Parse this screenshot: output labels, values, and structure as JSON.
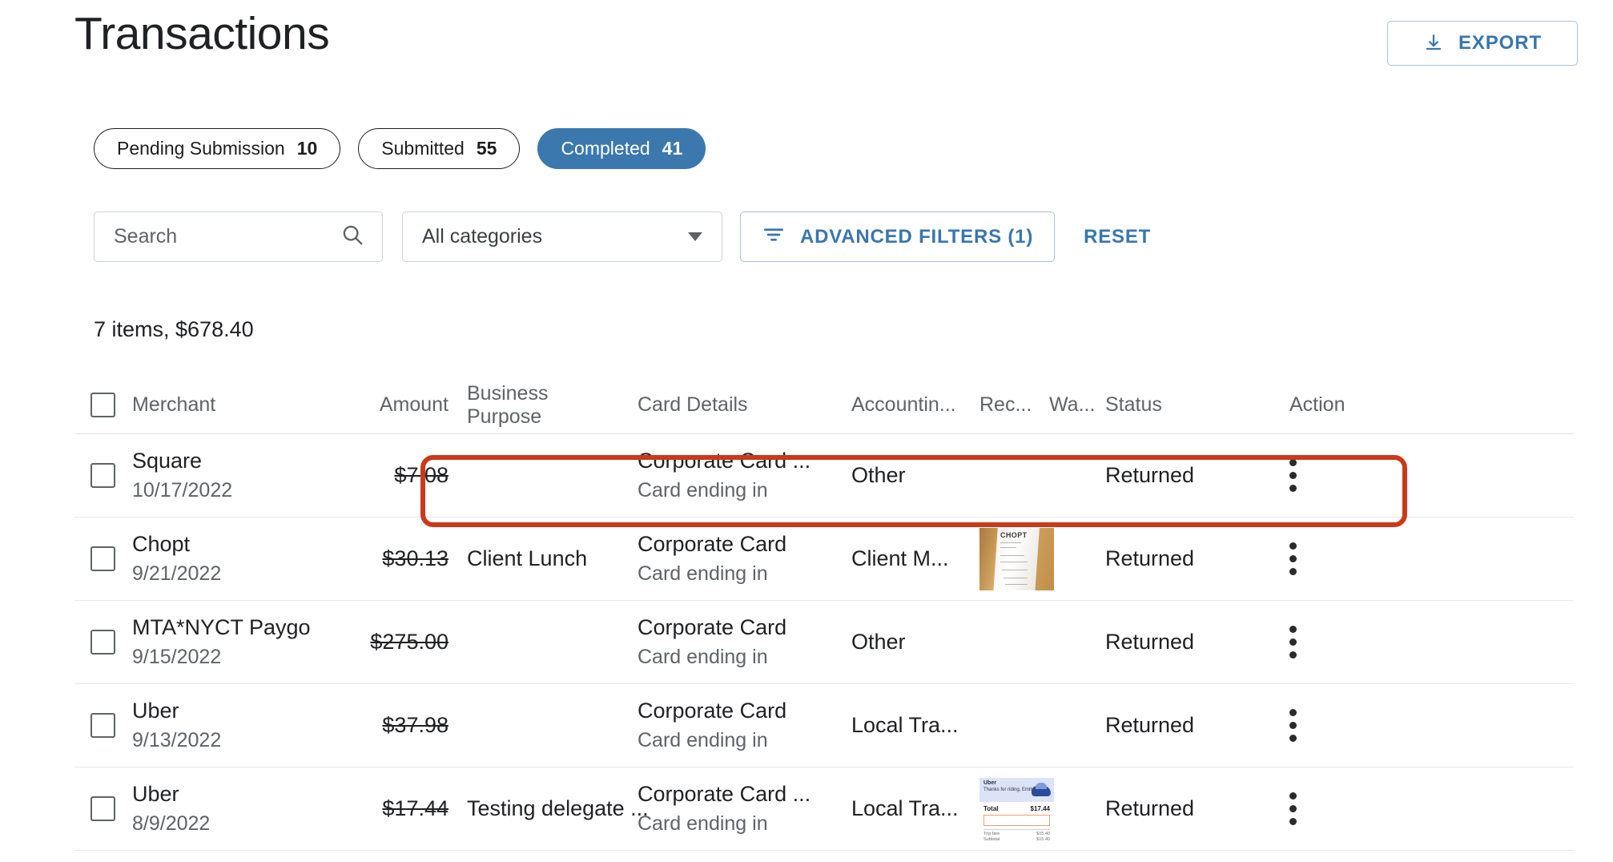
{
  "header": {
    "title": "Transactions",
    "export_label": "EXPORT",
    "export_icon": "download-icon"
  },
  "tabs": [
    {
      "label": "Pending Submission",
      "count": "10",
      "active": false
    },
    {
      "label": "Submitted",
      "count": "55",
      "active": false
    },
    {
      "label": "Completed",
      "count": "41",
      "active": true
    }
  ],
  "filters": {
    "search_placeholder": "Search",
    "search_value": "",
    "search_icon": "search-icon",
    "category_selected": "All categories",
    "category_icon": "chevron-down-icon",
    "advanced_filters_label": "ADVANCED FILTERS  (1)",
    "advanced_filters_icon": "filter-icon",
    "reset_label": "RESET"
  },
  "summary": "7 items, $678.40",
  "table": {
    "columns": [
      "Merchant",
      "Amount",
      "Business Purpose",
      "Card Details",
      "Accountin...",
      "Rec...",
      "Wa...",
      "Status",
      "Action"
    ],
    "rows": [
      {
        "merchant": "Square",
        "date": "10/17/2022",
        "amount": "$7.08",
        "purpose": "",
        "card": "Corporate Card ...",
        "card_sub": "Card ending in",
        "accounting": "Other",
        "receipt": "",
        "wallet": "",
        "status": "Returned",
        "action_icon": "more-vertical-icon"
      },
      {
        "merchant": "Chopt",
        "date": "9/21/2022",
        "amount": "$30.13",
        "purpose": "Client Lunch",
        "card": "Corporate Card",
        "card_sub": "Card ending in",
        "accounting": "Client M...",
        "receipt": "chopt-receipt-thumbnail",
        "wallet": "",
        "status": "Returned",
        "action_icon": "more-vertical-icon"
      },
      {
        "merchant": "MTA*NYCT Paygo",
        "date": "9/15/2022",
        "amount": "$275.00",
        "purpose": "",
        "card": "Corporate Card",
        "card_sub": "Card ending in",
        "accounting": "Other",
        "receipt": "",
        "wallet": "",
        "status": "Returned",
        "action_icon": "more-vertical-icon"
      },
      {
        "merchant": "Uber",
        "date": "9/13/2022",
        "amount": "$37.98",
        "purpose": "",
        "card": "Corporate Card",
        "card_sub": "Card ending in",
        "accounting": "Local Tra...",
        "receipt": "",
        "wallet": "",
        "status": "Returned",
        "action_icon": "more-vertical-icon"
      },
      {
        "merchant": "Uber",
        "date": "8/9/2022",
        "amount": "$17.44",
        "purpose": "Testing delegate ...",
        "card": "Corporate Card ...",
        "card_sub": "Card ending in",
        "accounting": "Local Tra...",
        "receipt": "uber-receipt-thumbnail",
        "wallet": "",
        "status": "Returned",
        "action_icon": "more-vertical-icon"
      }
    ]
  },
  "receipt_uber": {
    "brand": "Uber",
    "thanks": "Thanks for riding, Emily",
    "total_label": "Total",
    "total_value": "$17.44"
  },
  "receipt_chopt": {
    "brand": "CHOPT"
  },
  "annotation": {
    "type": "red-highlight-rectangle",
    "target_row": "Square",
    "color": "#c9391b"
  },
  "colors": {
    "accent_blue": "#3b78ad",
    "link_blue": "#3a76ad",
    "text_primary": "#202124",
    "text_secondary": "#5f6368",
    "highlight_red": "#c9391b"
  }
}
